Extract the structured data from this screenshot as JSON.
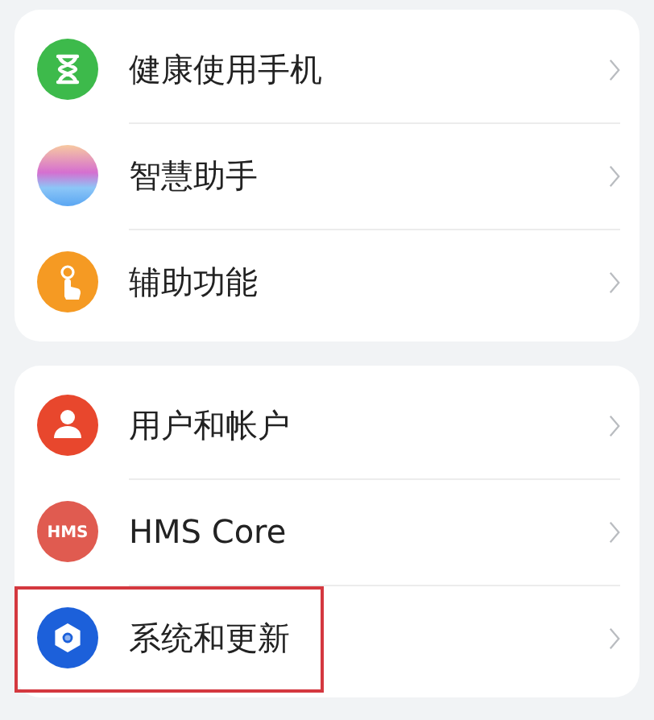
{
  "groups": [
    {
      "items": [
        {
          "label": "健康使用手机",
          "highlighted": false
        },
        {
          "label": "智慧助手",
          "highlighted": false
        },
        {
          "label": "辅助功能",
          "highlighted": false
        }
      ]
    },
    {
      "items": [
        {
          "label": "用户和帐户",
          "highlighted": false
        },
        {
          "label": "HMS Core",
          "icon_text": "HMS",
          "highlighted": false
        },
        {
          "label": "系统和更新",
          "highlighted": true
        }
      ]
    }
  ]
}
